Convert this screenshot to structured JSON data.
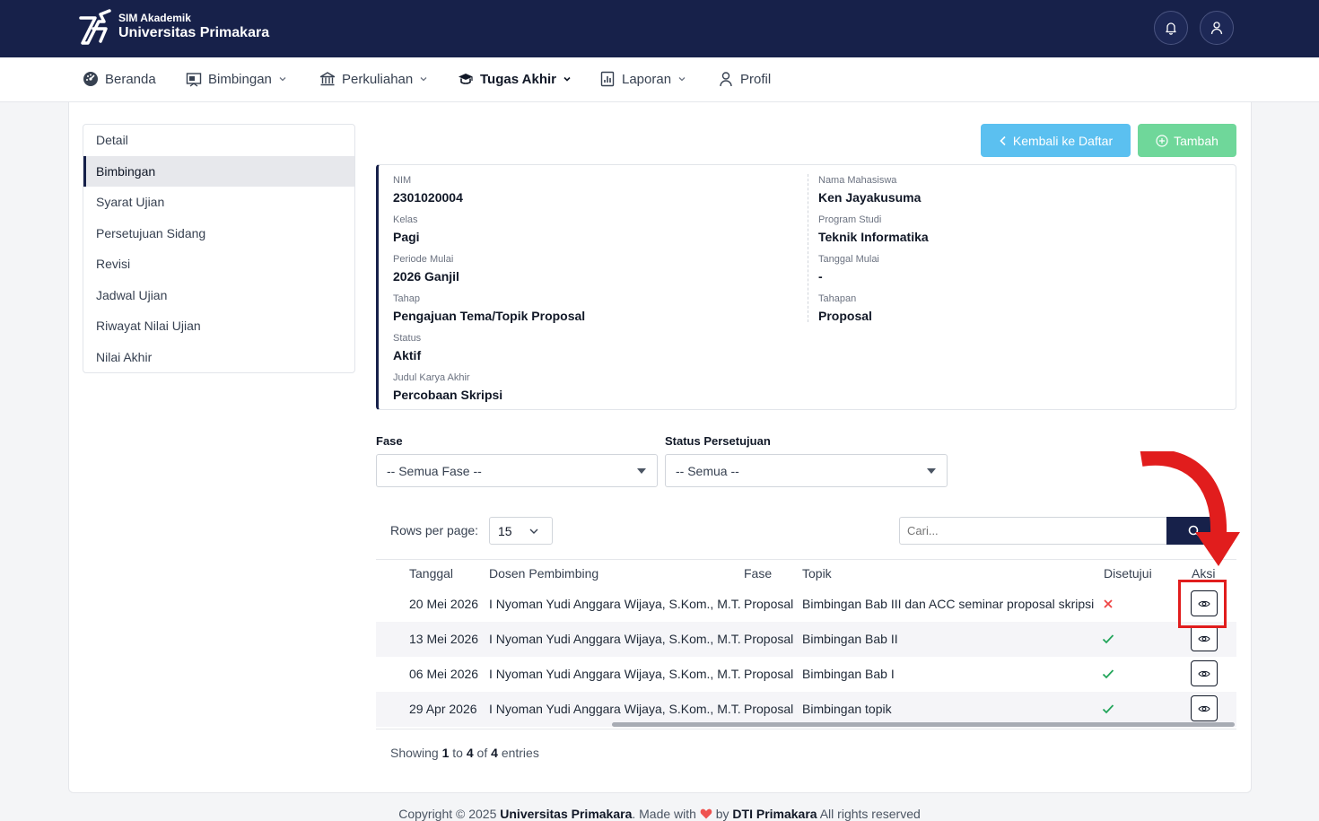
{
  "header": {
    "app_subtitle": "SIM Akademik",
    "app_title": "Universitas Primakara",
    "bell_icon": "bell-icon",
    "user_icon": "user-icon"
  },
  "nav": {
    "items": [
      {
        "label": "Beranda",
        "icon": "dashboard-icon"
      },
      {
        "label": "Bimbingan",
        "icon": "presentation-icon"
      },
      {
        "label": "Perkuliahan",
        "icon": "building-icon"
      },
      {
        "label": "Tugas Akhir",
        "icon": "graduation-cap-icon"
      },
      {
        "label": "Laporan",
        "icon": "chart-report-icon"
      },
      {
        "label": "Profil",
        "icon": "user-icon"
      }
    ],
    "active": "Tugas Akhir"
  },
  "side_menu": {
    "items": [
      "Detail",
      "Bimbingan",
      "Syarat Ujian",
      "Persetujuan Sidang",
      "Revisi",
      "Jadwal Ujian",
      "Riwayat Nilai Ujian",
      "Nilai Akhir"
    ],
    "active": "Bimbingan"
  },
  "actions": {
    "back_label": "Kembali ke Daftar",
    "add_label": "Tambah"
  },
  "info": {
    "nim": {
      "label": "NIM",
      "value": "2301020004"
    },
    "nama": {
      "label": "Nama Mahasiswa",
      "value": "Ken Jayakusuma"
    },
    "kelas": {
      "label": "Kelas",
      "value": "Pagi"
    },
    "prodi": {
      "label": "Program Studi",
      "value": "Teknik Informatika"
    },
    "periode": {
      "label": "Periode Mulai",
      "value": "2026 Ganjil"
    },
    "tanggal": {
      "label": "Tanggal Mulai",
      "value": "-"
    },
    "tahap": {
      "label": "Tahap",
      "value": "Pengajuan Tema/Topik Proposal"
    },
    "tahapan": {
      "label": "Tahapan",
      "value": "Proposal"
    },
    "status": {
      "label": "Status",
      "value": "Aktif"
    },
    "judul": {
      "label": "Judul Karya Akhir",
      "value": "Percobaan Skripsi"
    }
  },
  "filters": {
    "fase_label": "Fase",
    "fase_value": "-- Semua Fase --",
    "status_label": "Status Persetujuan",
    "status_value": "-- Semua --"
  },
  "table_controls": {
    "rows_label": "Rows per page:",
    "rows_value": "15",
    "search_placeholder": "Cari..."
  },
  "table": {
    "columns": [
      "Tanggal",
      "Dosen Pembimbing",
      "Fase",
      "Topik",
      "Disetujui",
      "Aksi"
    ],
    "rows": [
      {
        "tanggal": "20 Mei 2026",
        "dosen": "I Nyoman Yudi Anggara Wijaya, S.Kom., M.T.",
        "fase": "Proposal",
        "topik": "Bimbingan Bab III dan ACC seminar proposal skripsi",
        "disetujui": false
      },
      {
        "tanggal": "13 Mei 2026",
        "dosen": "I Nyoman Yudi Anggara Wijaya, S.Kom., M.T.",
        "fase": "Proposal",
        "topik": "Bimbingan Bab II",
        "disetujui": true
      },
      {
        "tanggal": "06 Mei 2026",
        "dosen": "I Nyoman Yudi Anggara Wijaya, S.Kom., M.T.",
        "fase": "Proposal",
        "topik": "Bimbingan Bab I",
        "disetujui": true
      },
      {
        "tanggal": "29 Apr 2026",
        "dosen": "I Nyoman Yudi Anggara Wijaya, S.Kom., M.T.",
        "fase": "Proposal",
        "topik": "Bimbingan topik",
        "disetujui": true
      }
    ]
  },
  "pagination": {
    "prefix": "Showing",
    "from": "1",
    "to_word": "to",
    "to": "4",
    "of_word": "of",
    "total": "4",
    "suffix": "entries"
  },
  "footer": {
    "text_1": "Copyright © 2025",
    "org": "Universitas Primakara",
    "text_2": ". Made with",
    "text_3": "by",
    "team": "DTI Primakara",
    "text_4": "All rights reserved"
  },
  "colors": {
    "primary": "#17214a",
    "info_button": "#5bc0f0",
    "success_button": "#6fd79a",
    "approved": "#22a55a",
    "rejected": "#ef4444",
    "annotation": "#e11d1d"
  }
}
